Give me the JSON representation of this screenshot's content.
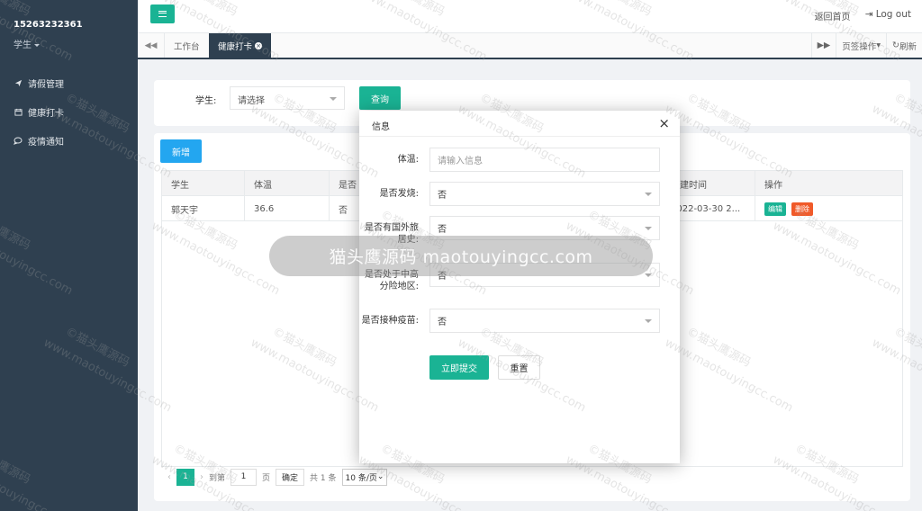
{
  "sidebar": {
    "username": "15263232361",
    "role": "学生",
    "items": [
      {
        "label": "请假管理",
        "icon": "send-icon"
      },
      {
        "label": "健康打卡",
        "icon": "calendar-icon"
      },
      {
        "label": "疫情通知",
        "icon": "comment-icon"
      }
    ]
  },
  "topbar": {
    "home_label": "返回首页",
    "logout_label": "Log out"
  },
  "tabs": {
    "items": [
      {
        "label": "工作台"
      },
      {
        "label": "健康打卡"
      }
    ],
    "page_ops_label": "页签操作",
    "refresh_label": "刷新"
  },
  "search": {
    "label": "学生:",
    "placeholder": "请选择",
    "query_label": "查询"
  },
  "table": {
    "add_label": "新增",
    "columns": [
      "学生",
      "体温",
      "是否",
      "创建时间",
      "操作"
    ],
    "rows": [
      {
        "student": "郭天宇",
        "temp": "36.6",
        "fever": "否",
        "created": "2022-03-30 2...",
        "edit": "编辑",
        "delete": "删除"
      }
    ]
  },
  "pager": {
    "current": "1",
    "goto_label": "到第",
    "page_input": "1",
    "page_unit": "页",
    "confirm_label": "确定",
    "total": "共 1 条",
    "page_size": "10 条/页"
  },
  "modal": {
    "title": "信息",
    "fields": [
      {
        "label": "体温:",
        "value": "请输入信息"
      },
      {
        "label": "是否发烧:",
        "value": "否"
      },
      {
        "label": "是否有国外旅居史:",
        "value": "否"
      },
      {
        "label": "是否处于中高分险地区:",
        "value": "否"
      },
      {
        "label": "是否接种疫苗:",
        "value": "否"
      }
    ],
    "submit_label": "立即提交",
    "reset_label": "重置"
  },
  "watermark": {
    "text": "©猫头鹰源码",
    "url": "www.maotouyingcc.com",
    "pill_text": "猫头鹰源码 maotouyingcc.com"
  },
  "colors": {
    "sidebar_bg": "#2f4050",
    "accent": "#1ab394",
    "add_blue": "#23a6f0",
    "danger": "#f05a2a"
  }
}
